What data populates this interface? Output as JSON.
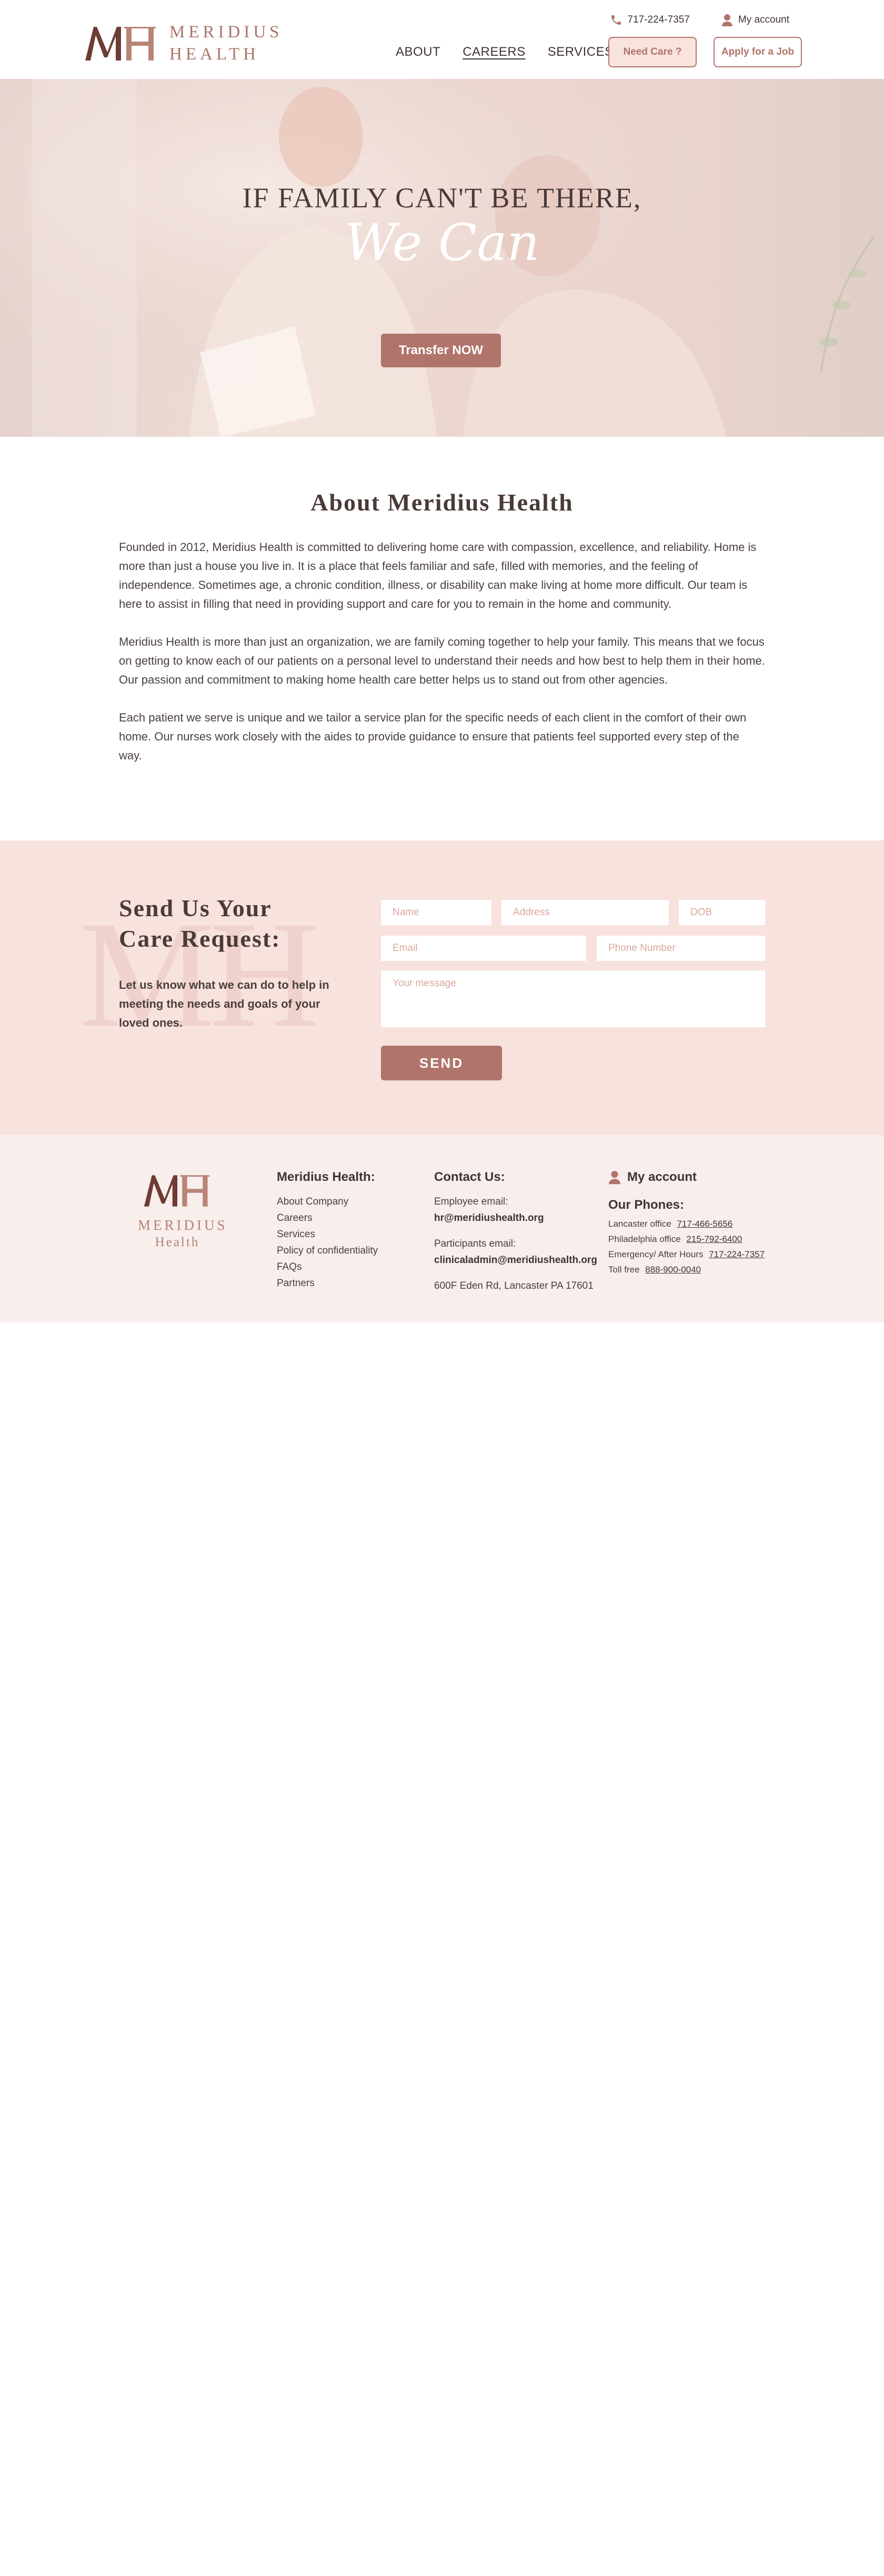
{
  "header": {
    "logo_line1": "MERIDIUS",
    "logo_line2": "HEALTH",
    "phone": "717-224-7357",
    "my_account": "My account",
    "nav": [
      {
        "label": "ABOUT"
      },
      {
        "label": "CAREERS"
      },
      {
        "label": "SERVICES"
      }
    ],
    "need_care": "Need Care ?",
    "apply_job": "Apply for a Job"
  },
  "hero": {
    "title": "IF FAMILY CAN'T BE THERE,",
    "script": "We Can",
    "button": "Transfer NOW"
  },
  "about": {
    "title": "About Meridius Health",
    "p1": "Founded in 2012, Meridius Health is committed to delivering home care with compassion, excellence, and reliability. Home is more than just a house you live in. It is a place that feels familiar and safe, filled with memories, and the feeling of independence. Sometimes age, a chronic condition, illness, or disability can make living at home more difficult. Our team is here to assist in filling that need in providing support and care for you to remain in the home and community.",
    "p2": "Meridius Health is more than just an organization, we are family coming together to help your family. This means that we focus on getting to know each of our patients on a personal level to understand their needs and how best to help them in their home.",
    "p3": "Our passion and commitment to making home health care better helps us to stand out from other agencies.",
    "p4": "Each patient we serve is unique and we tailor a service plan for the specific needs of each client in the comfort of their own home. Our nurses work closely with the aides to provide guidance to ensure that patients feel supported every step of the way."
  },
  "care": {
    "title_line1": "Send Us Your",
    "title_line2": "Care Request:",
    "text": "Let us know what we can do to help in meeting the needs and goals of your loved ones.",
    "placeholders": {
      "name": "Name",
      "address": "Address",
      "dob": "DOB",
      "email": "Email",
      "phone": "Phone Number",
      "message": "Your message"
    },
    "send": "SEND"
  },
  "footer": {
    "logo_line1": "MERIDIUS",
    "logo_line2": "Health",
    "company_head": "Meridius Health:",
    "company_links": [
      "About Company",
      "Careers",
      "Services",
      "Policy of confidentiality",
      "FAQs",
      "Partners"
    ],
    "contact_head": "Contact Us:",
    "employee_label": "Employee email:",
    "employee_email": "hr@meridiushealth.org",
    "participants_label": "Participants email:",
    "participants_email": "clinicaladmin@meridiushealth.org",
    "address": "600F Eden Rd, Lancaster PA 17601",
    "my_account": "My account",
    "phones_head": "Our Phones:",
    "phones": [
      {
        "label": "Lancaster office",
        "number": "717-466-5656"
      },
      {
        "label": "Philadelphia office",
        "number": "215-792-6400"
      },
      {
        "label": "Emergency/ After Hours",
        "number": "717-224-7357"
      },
      {
        "label": "Toll free",
        "number": "888-900-0040"
      }
    ]
  },
  "colors": {
    "accent": "#b0746a",
    "accent_light": "#f9e3de",
    "care_bg": "#f8e2dd",
    "footer_bg": "#f8eeec"
  }
}
